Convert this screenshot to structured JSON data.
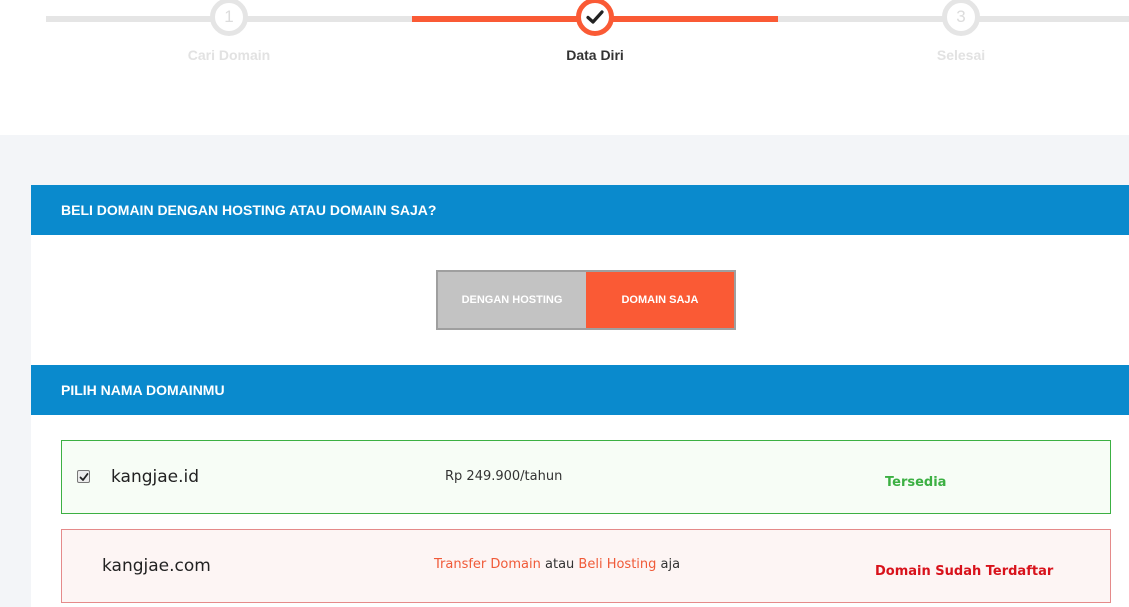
{
  "stepper": {
    "steps": [
      {
        "number": "1",
        "label": "Cari Domain",
        "state": "inactive"
      },
      {
        "number": "",
        "label": "Data Diri",
        "state": "active",
        "icon": "check-icon"
      },
      {
        "number": "3",
        "label": "Selesai",
        "state": "inactive"
      }
    ]
  },
  "purchase_type": {
    "heading": "BELI DOMAIN DENGAN HOSTING ATAU DOMAIN SAJA?",
    "options": [
      "DENGAN HOSTING",
      "DOMAIN SAJA"
    ],
    "selected": "DOMAIN SAJA"
  },
  "domain_choice": {
    "heading": "PILIH NAMA DOMAINMU",
    "results": [
      {
        "checked": true,
        "domain": "kangjae.id",
        "price": "Rp 249.900/tahun",
        "status": "Tersedia"
      },
      {
        "domain": "kangjae.com",
        "transfer_link": "Transfer Domain",
        "separator": "atau",
        "hosting_link": "Beli Hosting",
        "suffix": "aja",
        "status": "Domain Sudah Terdaftar"
      }
    ]
  },
  "colors": {
    "accent": "#fa5a35",
    "header_blue": "#0a8acd",
    "available_green": "#3cb043",
    "taken_red": "#d8121b"
  }
}
